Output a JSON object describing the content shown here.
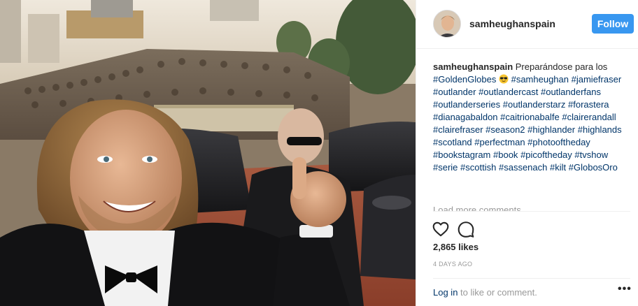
{
  "post": {
    "username": "samheughanspain",
    "follow_label": "Follow",
    "caption_author": "samheughanspain",
    "caption_text": "Preparándose para los",
    "hashtags_line1": [
      "#GoldenGlobes"
    ],
    "emoji": "sunglasses-emoji",
    "hashtags_rest": [
      "#samheughan",
      "#jamiefraser",
      "#outlander",
      "#outlandercast",
      "#outlanderfans",
      "#outlanderseries",
      "#outlanderstarz",
      "#forastera",
      "#dianagabaldon",
      "#caitrionabalfe",
      "#clairerandall",
      "#clairefraser",
      "#season2",
      "#highlander",
      "#highlands",
      "#scotland",
      "#perfectman",
      "#photooftheday",
      "#bookstagram",
      "#book",
      "#picoftheday",
      "#tvshow",
      "#serie",
      "#scottish",
      "#sassenach",
      "#kilt",
      "#GlobosOro"
    ],
    "load_more_label": "Load more comments",
    "likes": "2,865 likes",
    "timestamp": "4 DAYS AGO",
    "login_link": "Log in",
    "login_rest": " to like or comment.",
    "more_label": "•••"
  },
  "icons": {
    "heart": "heart-icon",
    "comment": "comment-icon",
    "more": "more-options-icon"
  },
  "colors": {
    "follow_button": "#3897f0",
    "link": "#003569",
    "muted": "#999999",
    "text": "#262626"
  }
}
